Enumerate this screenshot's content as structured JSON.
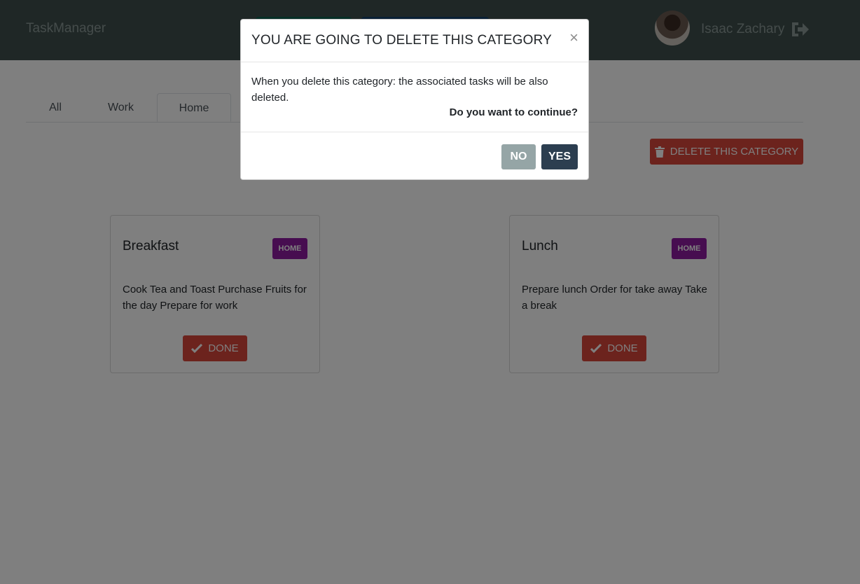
{
  "navbar": {
    "brand": "TaskManager",
    "user_name": "Isaac Zachary",
    "signout_icon": "sign-out-icon"
  },
  "tabs": [
    {
      "label": "All"
    },
    {
      "label": "Work"
    },
    {
      "label": "Home",
      "active": true
    }
  ],
  "toolbar": {
    "delete_category_label": "DELETE THIS CATEGORY",
    "delete_icon": "trash-icon"
  },
  "tasks": [
    {
      "title": "Breakfast",
      "badge": "HOME",
      "description": "Cook Tea and Toast Purchase Fruits for the day Prepare for work",
      "done_label": "DONE"
    },
    {
      "title": "Lunch",
      "badge": "HOME",
      "description": "Prepare lunch Order for take away Take a break",
      "done_label": "DONE"
    }
  ],
  "modal": {
    "title": "YOU ARE GOING TO DELETE THIS CATEGORY",
    "close_glyph": "×",
    "body": "When you delete this category: the associated tasks will be also deleted.",
    "question": "Do you want to continue?",
    "no_label": "NO",
    "yes_label": "YES"
  },
  "colors": {
    "navbar": "#3e4f4d",
    "danger": "#d9463a",
    "badge": "#8e1aa0",
    "no_button": "#95a5a6",
    "yes_button": "#2c3e50"
  }
}
